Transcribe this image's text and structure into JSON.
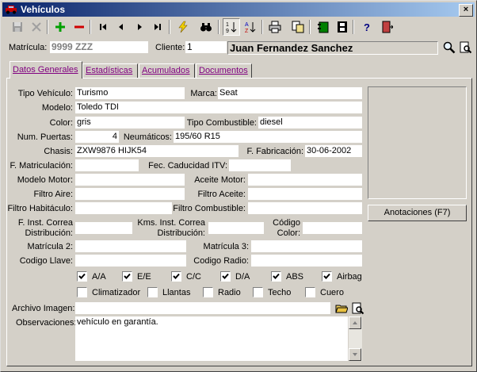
{
  "window": {
    "title": "Vehículos",
    "close_glyph": "×"
  },
  "toolbar": [
    "save-icon",
    "cancel-icon",
    "add-icon",
    "delete-icon",
    "first-icon",
    "prev-icon",
    "next-icon",
    "last-icon",
    "lightning-icon",
    "binoculars-icon",
    "sort-asc-icon",
    "sort-desc-icon",
    "print-icon",
    "copy-icon",
    "book-icon",
    "film-icon",
    "help-icon",
    "exit-icon"
  ],
  "header": {
    "matricula_label": "Matrícula:",
    "matricula_value": "9999 ZZZ",
    "cliente_label": "Cliente:",
    "cliente_value": "1",
    "cliente_name": "Juan Fernandez Sanchez"
  },
  "tabs": [
    {
      "label": "Datos Generales",
      "active": true
    },
    {
      "label": "Estadísticas",
      "active": false
    },
    {
      "label": "Acumulados",
      "active": false
    },
    {
      "label": "Documentos",
      "active": false
    }
  ],
  "form": {
    "tipo_vehiculo_label": "Tipo Vehículo:",
    "tipo_vehiculo": "Turismo",
    "marca_label": "Marca:",
    "marca": "Seat",
    "modelo_label": "Modelo:",
    "modelo": "Toledo TDI",
    "color_label": "Color:",
    "color": "gris",
    "tipo_combustible_label": "Tipo Combustible:",
    "tipo_combustible": "diesel",
    "num_puertas_label": "Num. Puertas:",
    "num_puertas": "4",
    "neumaticos_label": "Neumáticos:",
    "neumaticos": "195/60 R15",
    "chasis_label": "Chasis:",
    "chasis": "ZXW9876 HIJK54",
    "fabricacion_label": "F. Fabricación:",
    "fabricacion": "30-06-2002",
    "matriculacion_label": "F. Matriculación:",
    "matriculacion": "",
    "caducidad_itv_label": "Fec. Caducidad ITV:",
    "caducidad_itv": "",
    "modelo_motor_label": "Modelo Motor:",
    "modelo_motor": "",
    "aceite_motor_label": "Aceite Motor:",
    "aceite_motor": "",
    "filtro_aire_label": "Filtro Aire:",
    "filtro_aire": "",
    "filtro_aceite_label": "Filtro Aceite:",
    "filtro_aceite": "",
    "filtro_habitaculo_label": "Filtro Habitáculo:",
    "filtro_habitaculo": "",
    "filtro_combustible_label": "Filtro Combustible:",
    "filtro_combustible": "",
    "inst_correa_label_1": "F. Inst. Correa",
    "inst_correa_label_2": "Distribución:",
    "inst_correa": "",
    "kms_correa_label_1": "Kms. Inst. Correa",
    "kms_correa_label_2": "Distribución:",
    "kms_correa": "",
    "codigo_color_label_1": "Código",
    "codigo_color_label_2": "Color:",
    "codigo_color": "",
    "matricula2_label": "Matrícula 2:",
    "matricula2": "",
    "matricula3_label": "Matrícula 3:",
    "matricula3": "",
    "codigo_llave_label": "Codigo Llave:",
    "codigo_llave": "",
    "codigo_radio_label": "Codigo Radio:",
    "codigo_radio": "",
    "archivo_imagen_label": "Archivo Imagen:",
    "archivo_imagen": "",
    "observaciones_label": "Observaciones:",
    "observaciones": "vehículo en garantía.",
    "anotaciones_button": "Anotaciones (F7)"
  },
  "checkboxes": [
    {
      "label": "A/A",
      "checked": true
    },
    {
      "label": "E/E",
      "checked": true
    },
    {
      "label": "C/C",
      "checked": true
    },
    {
      "label": "D/A",
      "checked": true
    },
    {
      "label": "ABS",
      "checked": true
    },
    {
      "label": "Airbag",
      "checked": true
    },
    {
      "label": "Climatizador",
      "checked": false
    },
    {
      "label": "Llantas",
      "checked": false
    },
    {
      "label": "Radio",
      "checked": false
    },
    {
      "label": "Techo",
      "checked": false
    },
    {
      "label": "Cuero",
      "checked": false
    }
  ]
}
